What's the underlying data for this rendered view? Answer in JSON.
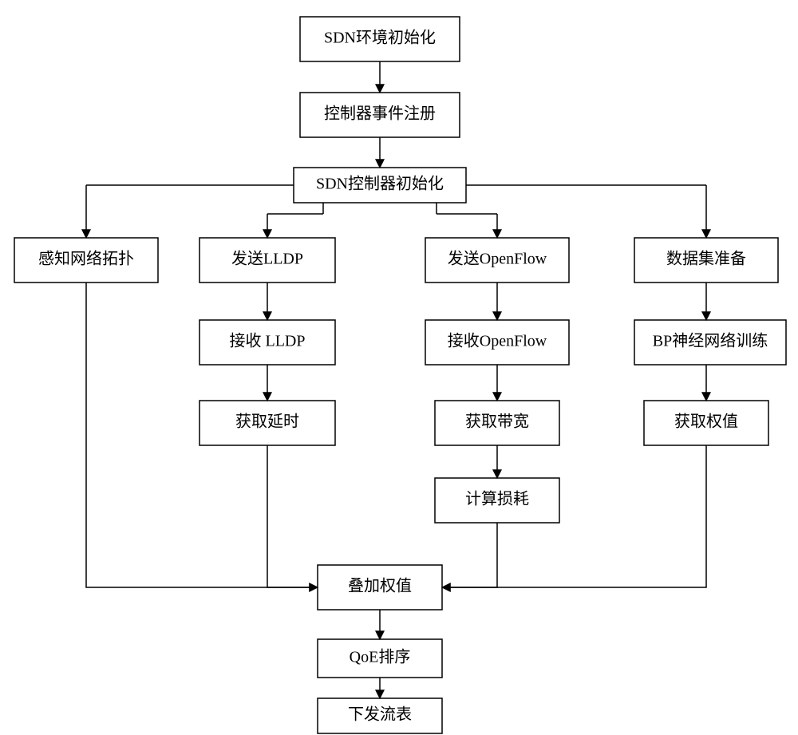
{
  "nodes": {
    "n1": "SDN环境初始化",
    "n2": "控制器事件注册",
    "n3": "SDN控制器初始化",
    "n4": "感知网络拓扑",
    "n5": "发送LLDP",
    "n6": "接收 LLDP",
    "n7": "获取延时",
    "n8": "发送OpenFlow",
    "n9": "接收OpenFlow",
    "n10": "获取带宽",
    "n11": "计算损耗",
    "n12": "数据集准备",
    "n13": "BP神经网络训练",
    "n14": "获取权值",
    "n15": "叠加权值",
    "n16": "QoE排序",
    "n17": "下发流表"
  }
}
